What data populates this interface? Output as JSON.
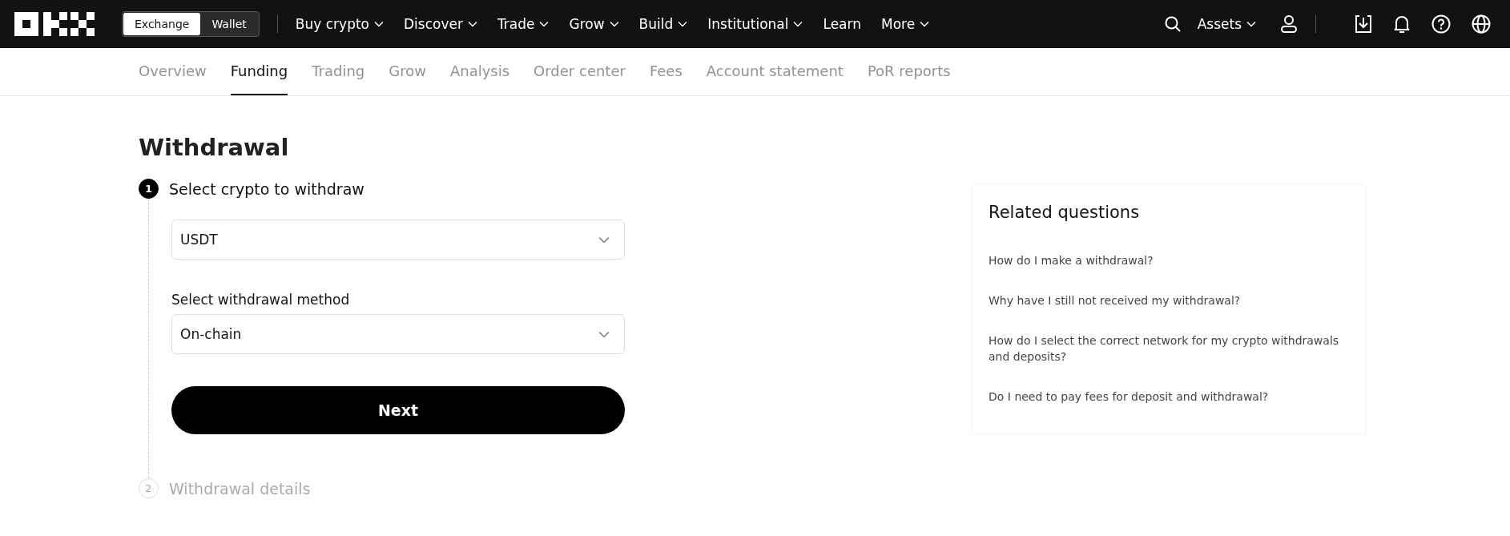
{
  "topbar": {
    "mode_switch": [
      {
        "label": "Exchange",
        "selected": true
      },
      {
        "label": "Wallet",
        "selected": false
      }
    ],
    "nav": [
      {
        "label": "Buy crypto",
        "has_menu": true
      },
      {
        "label": "Discover",
        "has_menu": true
      },
      {
        "label": "Trade",
        "has_menu": true
      },
      {
        "label": "Grow",
        "has_menu": true
      },
      {
        "label": "Build",
        "has_menu": true
      },
      {
        "label": "Institutional",
        "has_menu": true
      },
      {
        "label": "Learn",
        "has_menu": false
      },
      {
        "label": "More",
        "has_menu": true
      }
    ],
    "assets": {
      "label": "Assets",
      "has_menu": true
    }
  },
  "tabs": [
    {
      "label": "Overview",
      "selected": false
    },
    {
      "label": "Funding",
      "selected": true
    },
    {
      "label": "Trading",
      "selected": false
    },
    {
      "label": "Grow",
      "selected": false
    },
    {
      "label": "Analysis",
      "selected": false
    },
    {
      "label": "Order center",
      "selected": false
    },
    {
      "label": "Fees",
      "selected": false
    },
    {
      "label": "Account statement",
      "selected": false
    },
    {
      "label": "PoR reports",
      "selected": false
    }
  ],
  "page_title": "Withdrawal",
  "steps": [
    {
      "number": "1",
      "title": "Select crypto to withdraw",
      "active": true
    },
    {
      "number": "2",
      "title": "Withdrawal details",
      "active": false
    }
  ],
  "form": {
    "crypto_select": {
      "value": "USDT"
    },
    "method_select": {
      "label": "Select withdrawal method",
      "value": "On-chain"
    },
    "next_button": "Next"
  },
  "related": {
    "title": "Related questions",
    "questions": [
      "How do I make a withdrawal?",
      "Why have I still not received my withdrawal?",
      "How do I select the correct network for my crypto withdrawals and deposits?",
      "Do I need to pay fees for deposit and withdrawal?"
    ]
  }
}
